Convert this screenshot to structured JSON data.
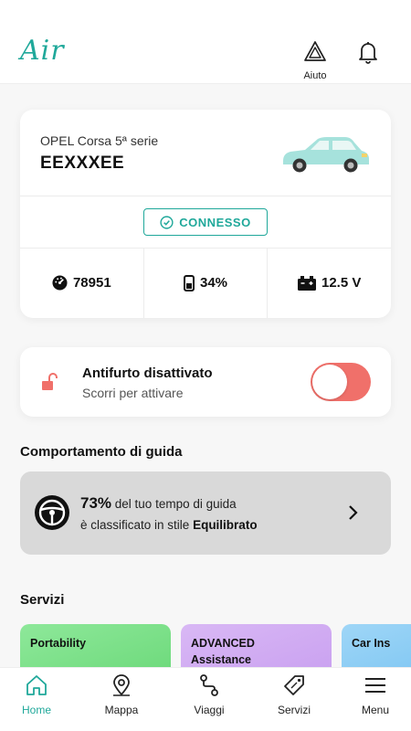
{
  "header": {
    "logo": "Air",
    "help_label": "Aiuto"
  },
  "vehicle": {
    "model": "OPEL Corsa 5ª serie",
    "plate": "EEXXXEE",
    "status": "CONNESSO",
    "odometer": "78951",
    "fuel": "34%",
    "battery": "12.5 V"
  },
  "alarm": {
    "title": "Antifurto disattivato",
    "subtitle": "Scorri per attivare",
    "enabled": false
  },
  "driving": {
    "section_title": "Comportamento di guida",
    "percent": "73%",
    "line1_rest": " del tuo tempo di guida",
    "line2_prefix": "è classificato in stile ",
    "style": "Equilibrato"
  },
  "services": {
    "section_title": "Servizi",
    "items": [
      {
        "label1": "Portability",
        "label2": ""
      },
      {
        "label1": "ADVANCED",
        "label2": "Assistance"
      },
      {
        "label1": "Car Ins",
        "label2": ""
      }
    ]
  },
  "tabs": [
    {
      "label": "Home",
      "icon": "home-icon",
      "active": true
    },
    {
      "label": "Mappa",
      "icon": "map-pin-icon"
    },
    {
      "label": "Viaggi",
      "icon": "route-icon"
    },
    {
      "label": "Servizi",
      "icon": "tag-icon"
    },
    {
      "label": "Menu",
      "icon": "hamburger-icon"
    }
  ],
  "colors": {
    "accent": "#1fa89a",
    "toggle_off": "#f0706a",
    "lock": "#f0706a"
  }
}
